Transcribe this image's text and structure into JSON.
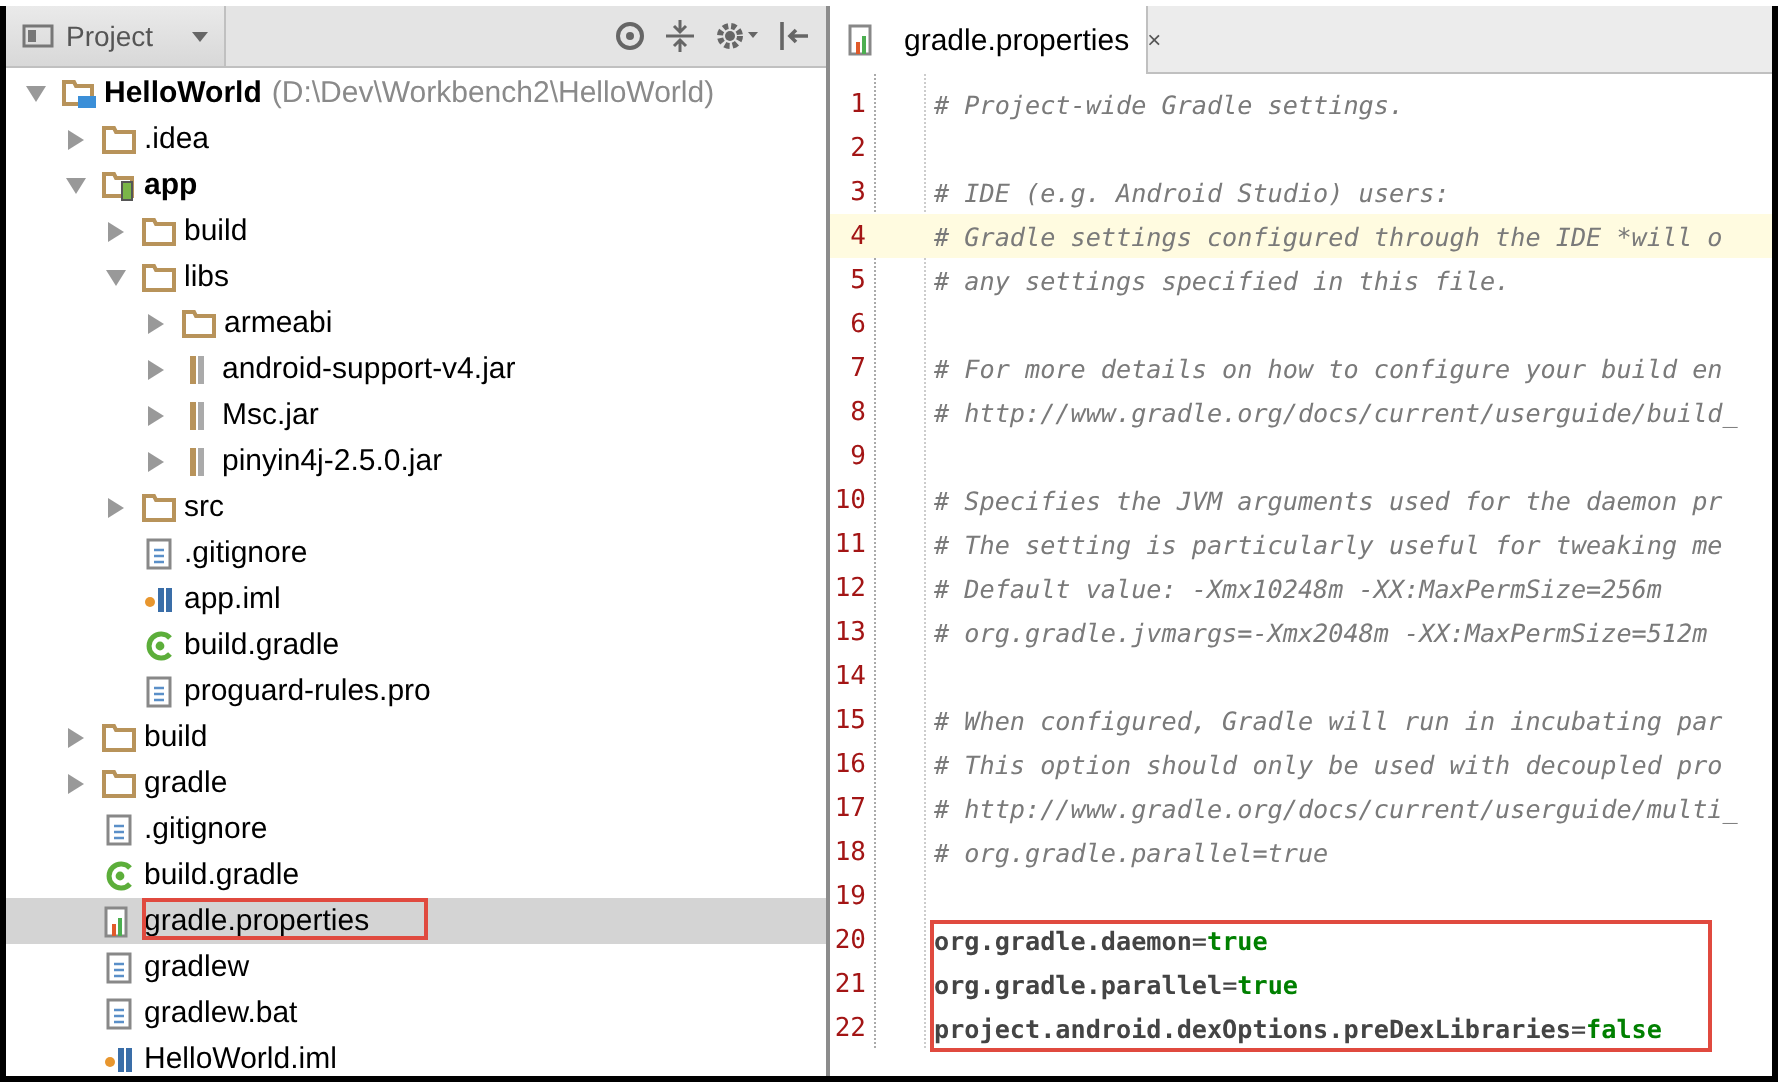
{
  "project_panel": {
    "view_selector": "Project",
    "tree": [
      {
        "label": "HelloWorld",
        "path": "(D:\\Dev\\Workbench2\\HelloWorld)",
        "kind": "module",
        "expanded": true,
        "selected": false,
        "annotated": false,
        "children": [
          {
            "label": ".idea",
            "kind": "folder",
            "expanded": false,
            "selected": false,
            "annotated": false
          },
          {
            "label": "app",
            "kind": "app-module",
            "expanded": true,
            "selected": false,
            "annotated": false,
            "children": [
              {
                "label": "build",
                "kind": "folder",
                "expanded": false,
                "selected": false,
                "annotated": false
              },
              {
                "label": "libs",
                "kind": "folder",
                "expanded": true,
                "selected": false,
                "annotated": false,
                "children": [
                  {
                    "label": "armeabi",
                    "kind": "folder",
                    "expanded": false,
                    "selected": false,
                    "annotated": false
                  },
                  {
                    "label": "android-support-v4.jar",
                    "kind": "jar",
                    "expanded": false,
                    "selected": false,
                    "annotated": false
                  },
                  {
                    "label": "Msc.jar",
                    "kind": "jar",
                    "expanded": false,
                    "selected": false,
                    "annotated": false
                  },
                  {
                    "label": "pinyin4j-2.5.0.jar",
                    "kind": "jar",
                    "expanded": false,
                    "selected": false,
                    "annotated": false
                  }
                ]
              },
              {
                "label": "src",
                "kind": "folder",
                "expanded": false,
                "selected": false,
                "annotated": false
              },
              {
                "label": ".gitignore",
                "kind": "text",
                "selected": false,
                "annotated": false
              },
              {
                "label": "app.iml",
                "kind": "iml",
                "selected": false,
                "annotated": false
              },
              {
                "label": "build.gradle",
                "kind": "gradle",
                "selected": false,
                "annotated": false
              },
              {
                "label": "proguard-rules.pro",
                "kind": "text",
                "selected": false,
                "annotated": false
              }
            ]
          },
          {
            "label": "build",
            "kind": "folder",
            "expanded": false,
            "selected": false,
            "annotated": false
          },
          {
            "label": "gradle",
            "kind": "folder",
            "expanded": false,
            "selected": false,
            "annotated": false
          },
          {
            "label": ".gitignore",
            "kind": "text",
            "selected": false,
            "annotated": false
          },
          {
            "label": "build.gradle",
            "kind": "gradle",
            "selected": false,
            "annotated": false
          },
          {
            "label": "gradle.properties",
            "kind": "properties",
            "selected": true,
            "annotated": true
          },
          {
            "label": "gradlew",
            "kind": "text",
            "selected": false,
            "annotated": false
          },
          {
            "label": "gradlew.bat",
            "kind": "text",
            "selected": false,
            "annotated": false
          },
          {
            "label": "HelloWorld.iml",
            "kind": "iml",
            "selected": false,
            "annotated": false
          }
        ]
      }
    ]
  },
  "editor": {
    "tab": {
      "title": "gradle.properties",
      "close": "×"
    },
    "lines": [
      {
        "number": "1",
        "kind": "comment",
        "text": "# Project-wide Gradle settings.",
        "current": false,
        "annotated": false
      },
      {
        "number": "2",
        "kind": "blank",
        "current": false,
        "annotated": false
      },
      {
        "number": "3",
        "kind": "comment",
        "text": "# IDE (e.g. Android Studio) users:",
        "current": false,
        "annotated": false
      },
      {
        "number": "4",
        "kind": "comment",
        "text": "# Gradle settings configured through the IDE *will o",
        "current": true,
        "annotated": false
      },
      {
        "number": "5",
        "kind": "comment",
        "text": "# any settings specified in this file.",
        "current": false,
        "annotated": false
      },
      {
        "number": "6",
        "kind": "blank",
        "current": false,
        "annotated": false
      },
      {
        "number": "7",
        "kind": "comment",
        "text": "# For more details on how to configure your build en",
        "current": false,
        "annotated": false
      },
      {
        "number": "8",
        "kind": "comment",
        "text": "# http://www.gradle.org/docs/current/userguide/build_",
        "current": false,
        "annotated": false
      },
      {
        "number": "9",
        "kind": "blank",
        "current": false,
        "annotated": false
      },
      {
        "number": "10",
        "kind": "comment",
        "text": "# Specifies the JVM arguments used for the daemon pr",
        "current": false,
        "annotated": false
      },
      {
        "number": "11",
        "kind": "comment",
        "text": "# The setting is particularly useful for tweaking me",
        "current": false,
        "annotated": false
      },
      {
        "number": "12",
        "kind": "comment",
        "text": "# Default value: -Xmx10248m -XX:MaxPermSize=256m",
        "current": false,
        "annotated": false
      },
      {
        "number": "13",
        "kind": "comment",
        "text": "# org.gradle.jvmargs=-Xmx2048m -XX:MaxPermSize=512m",
        "current": false,
        "annotated": false
      },
      {
        "number": "14",
        "kind": "blank",
        "current": false,
        "annotated": false
      },
      {
        "number": "15",
        "kind": "comment",
        "text": "# When configured, Gradle will run in incubating par",
        "current": false,
        "annotated": false
      },
      {
        "number": "16",
        "kind": "comment",
        "text": "# This option should only be used with decoupled pro",
        "current": false,
        "annotated": false
      },
      {
        "number": "17",
        "kind": "comment",
        "text": "# http://www.gradle.org/docs/current/userguide/multi_",
        "current": false,
        "annotated": false
      },
      {
        "number": "18",
        "kind": "comment",
        "text": "# org.gradle.parallel=true",
        "current": false,
        "annotated": false
      },
      {
        "number": "19",
        "kind": "blank",
        "current": false,
        "annotated": false
      },
      {
        "number": "20",
        "kind": "property",
        "key": "org.gradle.daemon",
        "separator": "=",
        "value": "true",
        "current": false,
        "annotated": true
      },
      {
        "number": "21",
        "kind": "property",
        "key": "org.gradle.parallel",
        "separator": "=",
        "value": "true",
        "current": false,
        "annotated": true
      },
      {
        "number": "22",
        "kind": "property",
        "key": "project.android.dexOptions.preDexLibraries",
        "separator": "=",
        "value": "false",
        "current": false,
        "annotated": true
      }
    ]
  }
}
